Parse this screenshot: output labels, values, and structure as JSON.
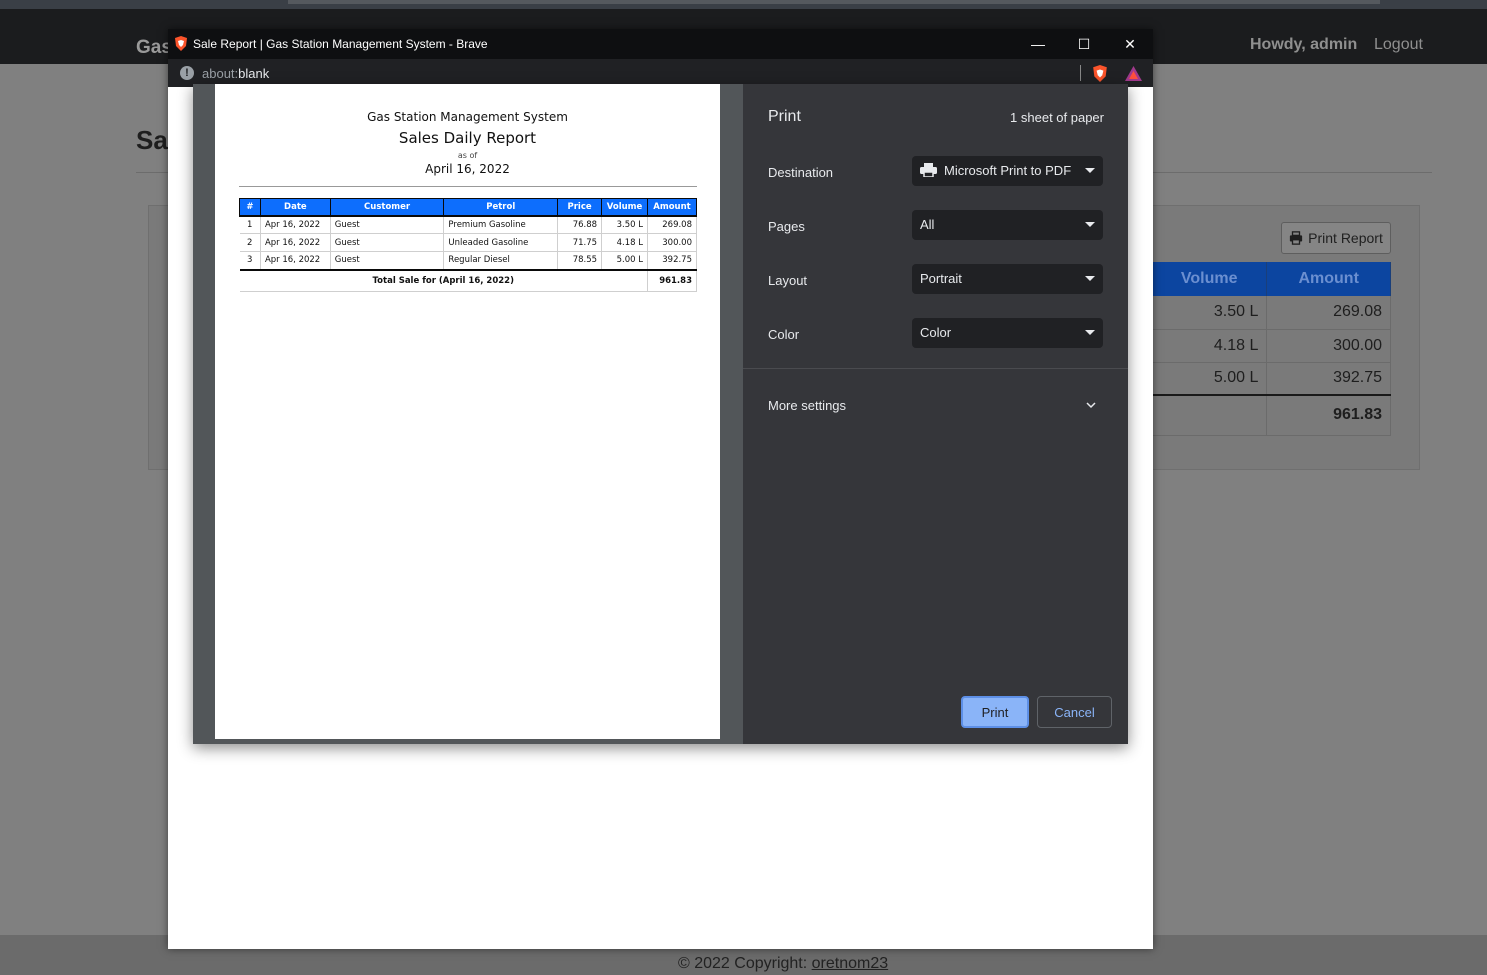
{
  "app": {
    "brand": "Gas",
    "user_greeting": "Howdy, admin",
    "logout": "Logout",
    "page_heading": "Sa",
    "print_report_button": "Print Report",
    "table_partial": {
      "headers": [
        "Volume",
        "Amount"
      ],
      "rows": [
        {
          "volume": "3.50 L",
          "amount": "269.08"
        },
        {
          "volume": "4.18 L",
          "amount": "300.00"
        },
        {
          "volume": "5.00 L",
          "amount": "392.75"
        }
      ],
      "total": "961.83",
      "edge_header": "t",
      "edge_cells": [
        "08",
        "00",
        "75",
        "83"
      ],
      "left_header": "#",
      "left_cells": [
        "1",
        "2",
        "3"
      ]
    },
    "footer": {
      "prefix": "© 2022 Copyright: ",
      "link": "oretnom23"
    }
  },
  "popup": {
    "window_title": "Sale Report | Gas Station Management System - Brave",
    "url_scheme": "about:",
    "url_path": "blank",
    "window_controls": {
      "minimize": "—",
      "maximize": "☐",
      "close": "✕"
    }
  },
  "report": {
    "system_name": "Gas Station Management System",
    "title": "Sales Daily Report",
    "as_of_label": "as of",
    "date": "April 16, 2022",
    "columns": [
      "#",
      "Date",
      "Customer",
      "Petrol",
      "Price",
      "Volume",
      "Amount"
    ],
    "rows": [
      {
        "no": "1",
        "date": "Apr 16, 2022",
        "customer": "Guest",
        "petrol": "Premium Gasoline",
        "price": "76.88",
        "volume": "3.50 L",
        "amount": "269.08"
      },
      {
        "no": "2",
        "date": "Apr 16, 2022",
        "customer": "Guest",
        "petrol": "Unleaded Gasoline",
        "price": "71.75",
        "volume": "4.18 L",
        "amount": "300.00"
      },
      {
        "no": "3",
        "date": "Apr 16, 2022",
        "customer": "Guest",
        "petrol": "Regular Diesel",
        "price": "78.55",
        "volume": "5.00 L",
        "amount": "392.75"
      }
    ],
    "total_label": "Total Sale for (April 16, 2022)",
    "total_amount": "961.83"
  },
  "print_settings": {
    "title": "Print",
    "sheets": "1 sheet of paper",
    "destination_label": "Destination",
    "destination_value": "Microsoft Print to PDF",
    "pages_label": "Pages",
    "pages_value": "All",
    "layout_label": "Layout",
    "layout_value": "Portrait",
    "color_label": "Color",
    "color_value": "Color",
    "more_settings": "More settings",
    "print_button": "Print",
    "cancel_button": "Cancel"
  },
  "colors": {
    "accent": "#8ab4f8",
    "report_header": "#0d6efd",
    "dialog_bg": "#35363a"
  }
}
